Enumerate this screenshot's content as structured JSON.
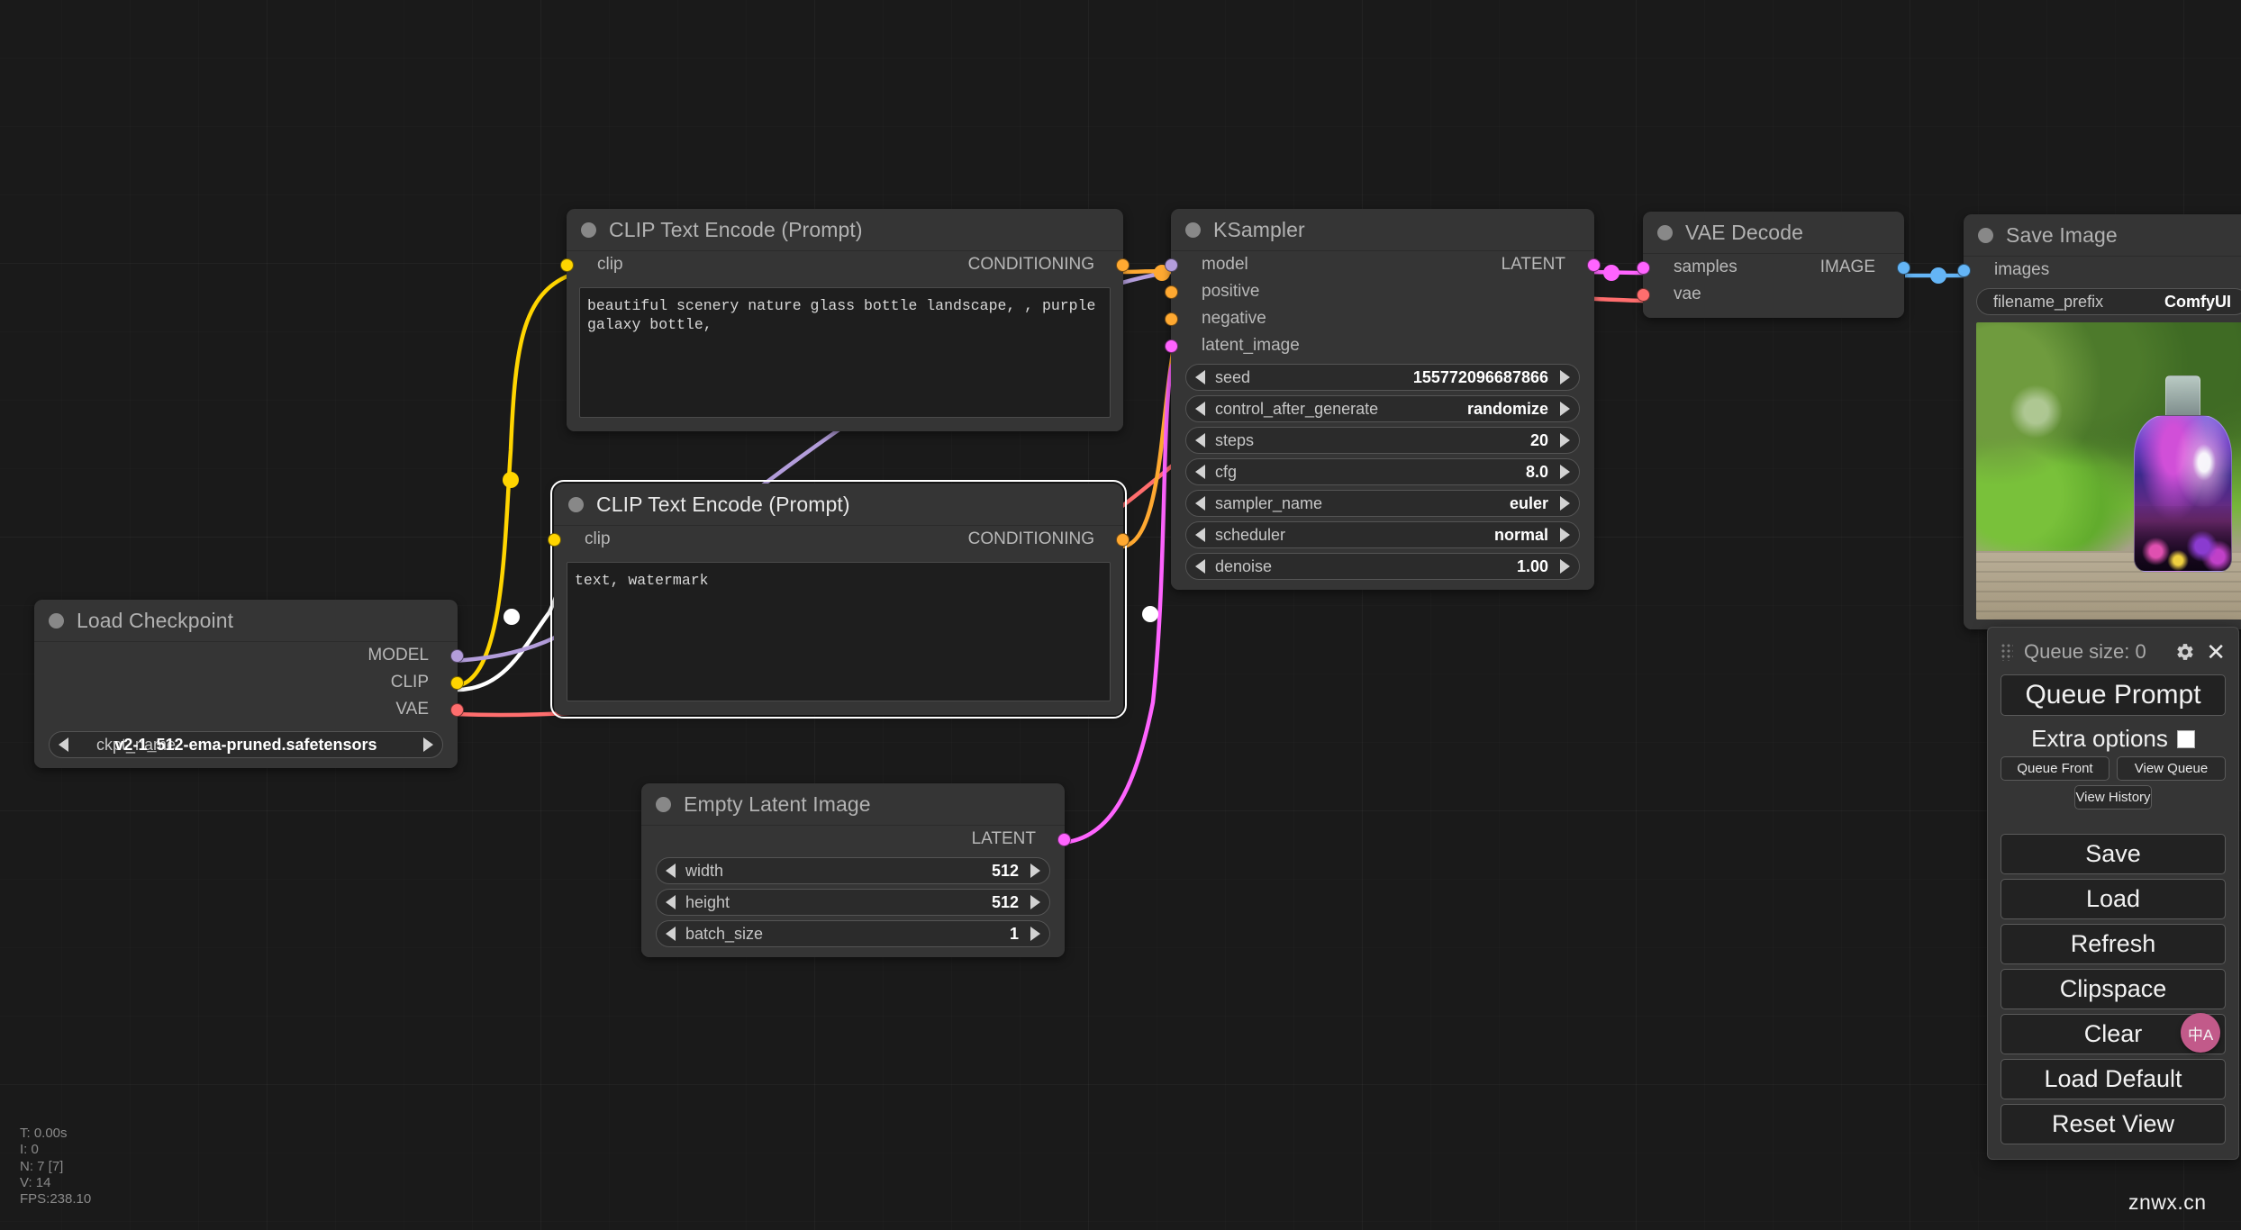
{
  "app": {
    "watermark": "znwx.cn"
  },
  "stats": {
    "text": "T: 0.00s\nI: 0\nN: 7 [7]\nV: 14\nFPS:238.10"
  },
  "nodes": {
    "clip_positive": {
      "title": "CLIP Text Encode (Prompt)",
      "input_clip": "clip",
      "output_conditioning": "CONDITIONING",
      "text": "beautiful scenery nature glass bottle landscape, , purple galaxy bottle,"
    },
    "clip_negative": {
      "title": "CLIP Text Encode (Prompt)",
      "input_clip": "clip",
      "output_conditioning": "CONDITIONING",
      "text": "text, watermark"
    },
    "ksampler": {
      "title": "KSampler",
      "inputs": [
        "model",
        "positive",
        "negative",
        "latent_image"
      ],
      "output_latent": "LATENT",
      "widgets": [
        {
          "name": "seed",
          "value": "155772096687866"
        },
        {
          "name": "control_after_generate",
          "value": "randomize"
        },
        {
          "name": "steps",
          "value": "20"
        },
        {
          "name": "cfg",
          "value": "8.0"
        },
        {
          "name": "sampler_name",
          "value": "euler"
        },
        {
          "name": "scheduler",
          "value": "normal"
        },
        {
          "name": "denoise",
          "value": "1.00"
        }
      ]
    },
    "vae_decode": {
      "title": "VAE Decode",
      "inputs": [
        "samples",
        "vae"
      ],
      "output_image": "IMAGE"
    },
    "save_image": {
      "title": "Save Image",
      "input_images": "images",
      "widget": {
        "name": "filename_prefix",
        "value": "ComfyUI"
      }
    },
    "load_checkpoint": {
      "title": "Load Checkpoint",
      "outputs": [
        "MODEL",
        "CLIP",
        "VAE"
      ],
      "widget": {
        "name": "ckpt_name",
        "value": "v2-1_512-ema-pruned.safetensors"
      }
    },
    "empty_latent": {
      "title": "Empty Latent Image",
      "output_latent": "LATENT",
      "widgets": [
        {
          "name": "width",
          "value": "512"
        },
        {
          "name": "height",
          "value": "512"
        },
        {
          "name": "batch_size",
          "value": "1"
        }
      ]
    }
  },
  "queue_panel": {
    "title": "Queue size: 0",
    "queue_prompt": "Queue Prompt",
    "extra_options": "Extra options",
    "queue_front": "Queue Front",
    "view_queue": "View Queue",
    "view_history": "View History",
    "buttons": [
      "Save",
      "Load",
      "Refresh",
      "Clipspace",
      "Clear",
      "Load Default",
      "Reset View"
    ]
  },
  "translate_button": {
    "label": "中A"
  },
  "colors": {
    "clip_link": "#FFD500",
    "model_link": "#B39DDB",
    "vae_link": "#FF6E6E",
    "conditioning_link": "#FFA931",
    "latent_link": "#FF64FF",
    "image_link": "#64B5F6",
    "selected_link": "#FFFFFF",
    "node_bg": "#353535",
    "canvas_bg": "#1a1a1a"
  }
}
